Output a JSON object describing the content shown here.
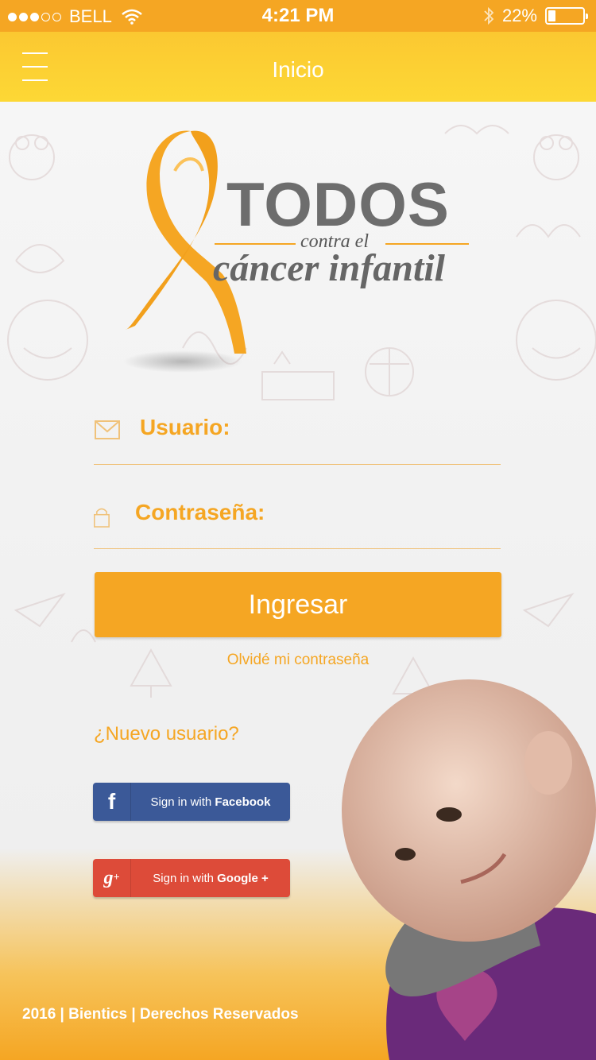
{
  "status_bar": {
    "carrier": "BELL",
    "time": "4:21 PM",
    "battery_percent": "22%",
    "battery_level": 0.22,
    "signal_bars_filled": 3,
    "signal_bars_total": 5
  },
  "nav": {
    "title": "Inicio",
    "menu_icon": "hamburger-menu-icon"
  },
  "logo": {
    "line1": "TODOS",
    "line2": "contra el",
    "line3": "cáncer infantil",
    "ribbon_color": "#f5a623"
  },
  "form": {
    "username_label": "Usuario:",
    "password_label": "Contraseña:",
    "login_button": "Ingresar",
    "forgot_password": "Olvidé mi contraseña"
  },
  "signup": {
    "prompt": "¿Nuevo usuario?",
    "facebook_prefix": "Sign in with ",
    "facebook_brand": "Facebook",
    "google_prefix": "Sign in with ",
    "google_brand": "Google +"
  },
  "footer": {
    "text": "2016 | Bientics | Derechos Reservados"
  },
  "colors": {
    "accent": "#f5a623",
    "nav_yellow": "#fdd835",
    "facebook": "#3b5998",
    "google": "#dd4b39",
    "logo_gray": "#6d6d6d"
  }
}
